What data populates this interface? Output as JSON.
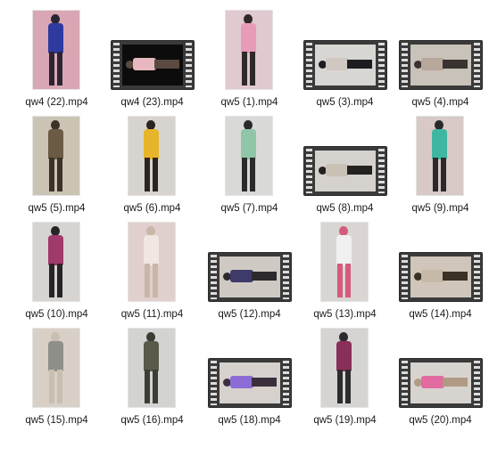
{
  "files": [
    {
      "name": "qw4 (22).mp4",
      "kind": "portrait",
      "bg": "#d9a7b3",
      "fill": "#2b2533",
      "accent": "#2e3aa0"
    },
    {
      "name": "qw4 (23).mp4",
      "kind": "film",
      "bg": "#0c0c0c",
      "fill": "#5a4a40",
      "accent": "#e8b8c0"
    },
    {
      "name": "qw5 (1).mp4",
      "kind": "portrait",
      "bg": "#e0c9cf",
      "fill": "#2f2a2a",
      "accent": "#e89bb8"
    },
    {
      "name": "qw5 (3).mp4",
      "kind": "film",
      "bg": "#d8d6d2",
      "fill": "#1d1c1f",
      "accent": "#cfc7c0"
    },
    {
      "name": "qw5 (4).mp4",
      "kind": "film",
      "bg": "#c8c2ba",
      "fill": "#3a3430",
      "accent": "#b8a89a"
    },
    {
      "name": "qw5 (5).mp4",
      "kind": "portrait",
      "bg": "#cbc4b4",
      "fill": "#3b3327",
      "accent": "#6b5a44"
    },
    {
      "name": "qw5 (6).mp4",
      "kind": "portrait",
      "bg": "#d7d3ce",
      "fill": "#2a2522",
      "accent": "#e6b52b"
    },
    {
      "name": "qw5 (7).mp4",
      "kind": "portrait",
      "bg": "#d9d9d7",
      "fill": "#2b2a2a",
      "accent": "#8fc6a8"
    },
    {
      "name": "qw5 (8).mp4",
      "kind": "film",
      "bg": "#d5d1cd",
      "fill": "#242220",
      "accent": "#c9c0b6"
    },
    {
      "name": "qw5 (9).mp4",
      "kind": "portrait",
      "bg": "#d8c8c6",
      "fill": "#2a2a2a",
      "accent": "#3fb7a0"
    },
    {
      "name": "qw5 (10).mp4",
      "kind": "portrait",
      "bg": "#d6d3d1",
      "fill": "#262426",
      "accent": "#a03a6a"
    },
    {
      "name": "qw5 (11).mp4",
      "kind": "portrait",
      "bg": "#e0cfcc",
      "fill": "#c9b6a8",
      "accent": "#f0e7e2"
    },
    {
      "name": "qw5 (12).mp4",
      "kind": "film",
      "bg": "#cfc9c4",
      "fill": "#2d2a2e",
      "accent": "#3e3a6a"
    },
    {
      "name": "qw5 (13).mp4",
      "kind": "portrait",
      "bg": "#d9d5d3",
      "fill": "#d45b7c",
      "accent": "#f0f0f0"
    },
    {
      "name": "qw5 (14).mp4",
      "kind": "film",
      "bg": "#cfc5bb",
      "fill": "#3a3026",
      "accent": "#c7b9a8"
    },
    {
      "name": "qw5 (15).mp4",
      "kind": "portrait",
      "bg": "#d8cfc6",
      "fill": "#c9bfb1",
      "accent": "#8e8e8a"
    },
    {
      "name": "qw5 (16).mp4",
      "kind": "portrait",
      "bg": "#d3d3d2",
      "fill": "#3c3d33",
      "accent": "#5a5a4a"
    },
    {
      "name": "qw5 (18).mp4",
      "kind": "film",
      "bg": "#d6d1cd",
      "fill": "#3a2f3a",
      "accent": "#8d6bd6"
    },
    {
      "name": "qw5 (19).mp4",
      "kind": "portrait",
      "bg": "#d6d4d2",
      "fill": "#2c2b2d",
      "accent": "#8a2f58"
    },
    {
      "name": "qw5 (20).mp4",
      "kind": "film",
      "bg": "#d7d3cf",
      "fill": "#b19a84",
      "accent": "#e26aa0"
    }
  ]
}
